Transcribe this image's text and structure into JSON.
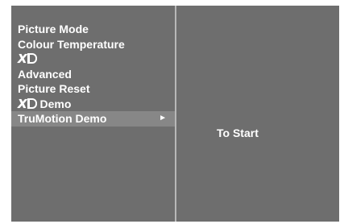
{
  "menu": {
    "items": [
      {
        "label": "Picture Mode",
        "selected": false
      },
      {
        "label": "Colour Temperature",
        "selected": false
      },
      {
        "logo": "XD",
        "label": "",
        "selected": false
      },
      {
        "label": "Advanced",
        "selected": false
      },
      {
        "label": "Picture Reset",
        "selected": false
      },
      {
        "logo": "XD",
        "label": "Demo",
        "selected": false
      },
      {
        "label": "TruMotion Demo",
        "selected": true,
        "arrow": "►"
      }
    ]
  },
  "submenu": {
    "action_label": "To Start"
  },
  "colors": {
    "osd_background": "#6e6e6e",
    "highlight": "#878787",
    "text": "#ffffff"
  }
}
